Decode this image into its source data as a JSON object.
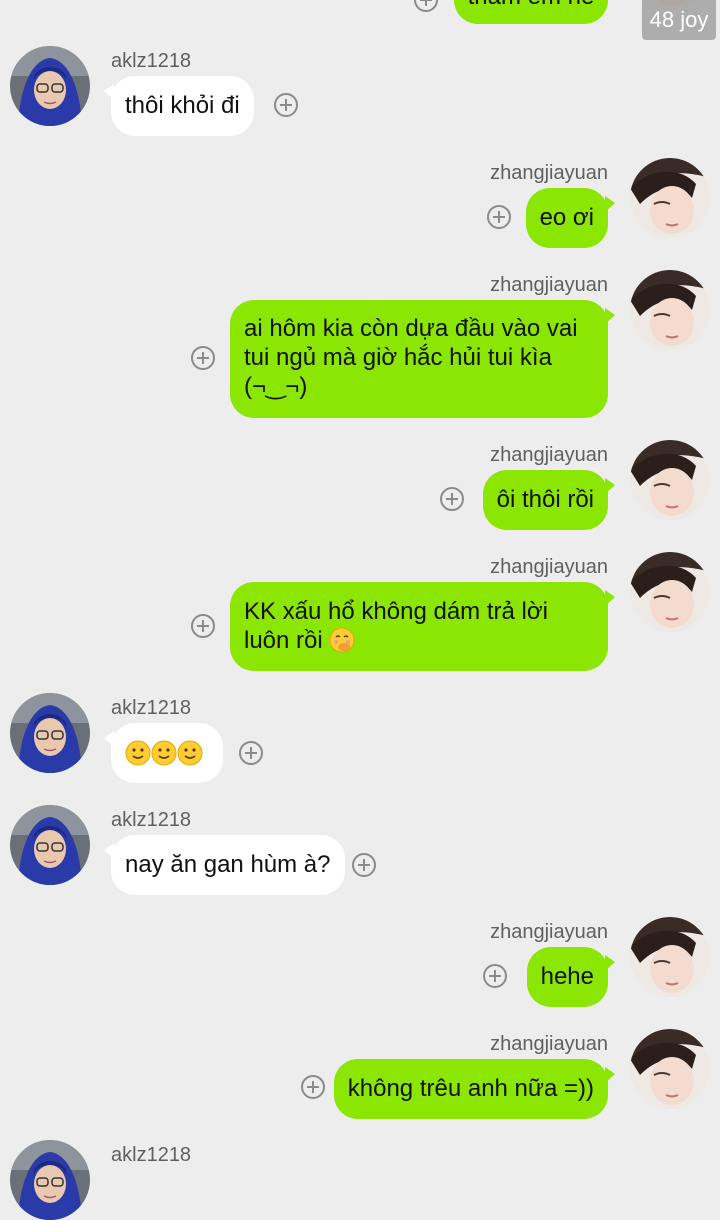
{
  "top_partial": {
    "bubble_text": "thăm em nè",
    "badge": "48 joy"
  },
  "messages": [
    {
      "user": "aklz1218",
      "text": "thôi khỏi đi"
    },
    {
      "user": "zhangjiayuan",
      "text": "eo ơi"
    },
    {
      "user": "zhangjiayuan",
      "line1": "ai hôm kia còn dựa đầu vào vai",
      "line2": "tui ngủ mà giờ hắc hủi tui kìa",
      "line3": "(¬‿¬)"
    },
    {
      "user": "zhangjiayuan",
      "text": "ôi thôi rồi"
    },
    {
      "user": "zhangjiayuan",
      "line1": "KK xấu hổ không dám trả lời",
      "line2": "luôn rồi",
      "emoji": "shushing-face"
    },
    {
      "user": "aklz1218",
      "emojis": [
        "slightly-smiling-face",
        "slightly-smiling-face",
        "slightly-smiling-face"
      ]
    },
    {
      "user": "aklz1218",
      "text": "nay ăn gan hùm à?"
    },
    {
      "user": "zhangjiayuan",
      "text": "hehe"
    },
    {
      "user": "zhangjiayuan",
      "text": "không trêu anh nữa =))"
    }
  ],
  "bottom_partial": {
    "user": "aklz1218"
  },
  "colors": {
    "background": "#ededed",
    "outgoing_bubble": "#8be603",
    "incoming_bubble": "#ffffff",
    "username": "#5f5f5f"
  }
}
